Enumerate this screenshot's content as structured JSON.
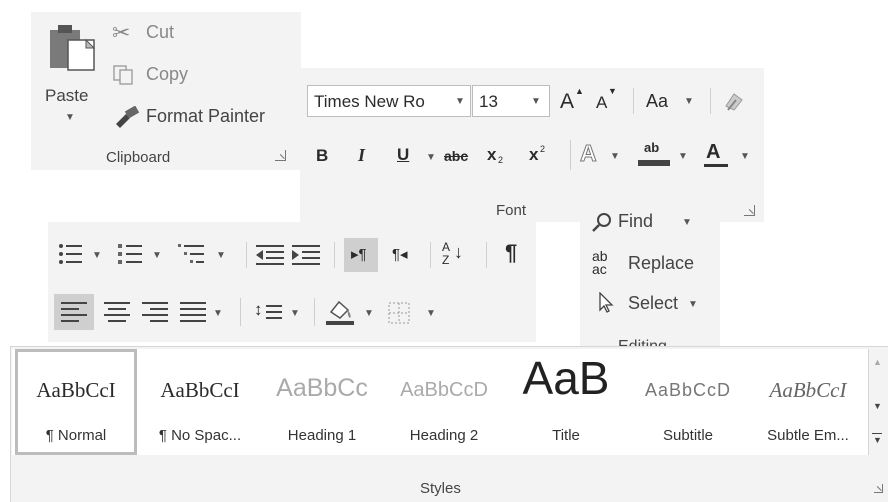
{
  "clipboard": {
    "paste": "Paste",
    "cut": "Cut",
    "copy": "Copy",
    "format_painter": "Format Painter",
    "group": "Clipboard"
  },
  "font": {
    "font_name": "Times New Ro",
    "font_size": "13",
    "grow": "A",
    "shrink": "A",
    "change_case": "Aa",
    "bold": "B",
    "italic": "I",
    "underline": "U",
    "strike": "abc",
    "subscript": "x",
    "subscript_mark": "2",
    "superscript": "x",
    "superscript_mark": "2",
    "highlight": "ab",
    "font_color": "A",
    "group": "Font"
  },
  "paragraph": {
    "show_marks": "¶"
  },
  "editing": {
    "find": "Find",
    "replace": "Replace",
    "select": "Select",
    "group": "Editing"
  },
  "styles": {
    "group": "Styles",
    "items": [
      {
        "sample": "AaBbCcI",
        "name": "¶ Normal"
      },
      {
        "sample": "AaBbCcI",
        "name": "¶ No Spac..."
      },
      {
        "sample": "AaBbCc",
        "name": "Heading 1"
      },
      {
        "sample": "AaBbCcD",
        "name": "Heading 2"
      },
      {
        "sample": "AaB",
        "name": "Title"
      },
      {
        "sample": "AaBbCcD",
        "name": "Subtitle"
      },
      {
        "sample": "AaBbCcI",
        "name": "Subtle Em..."
      }
    ]
  },
  "colors": {
    "panel": "#f3f3f3",
    "selected": "#cfcfcf",
    "text": "#2b2b2b"
  }
}
